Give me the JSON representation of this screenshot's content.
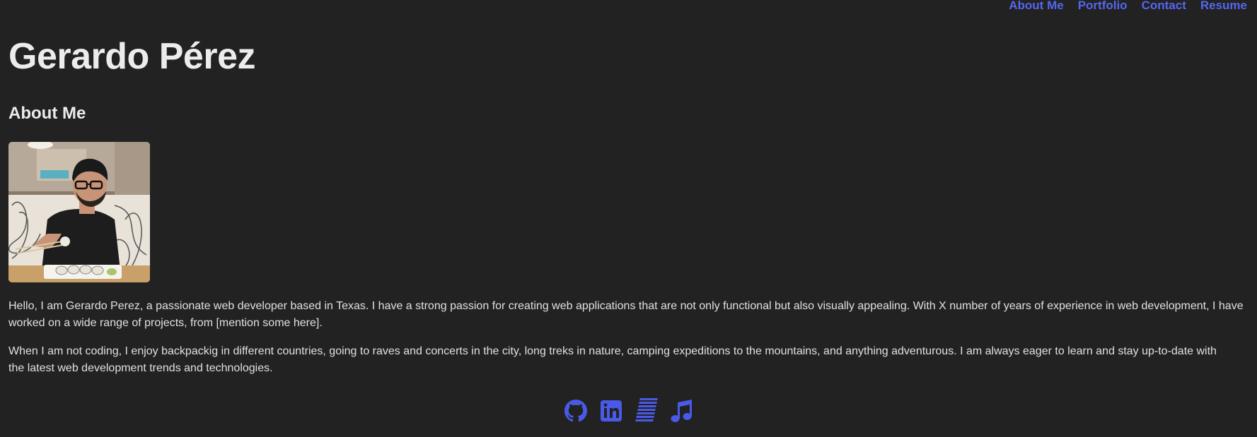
{
  "nav": {
    "items": [
      {
        "label": "About Me"
      },
      {
        "label": "Portfolio"
      },
      {
        "label": "Contact"
      },
      {
        "label": "Resume"
      }
    ]
  },
  "header": {
    "name": "Gerardo Pérez"
  },
  "about": {
    "title": "About Me",
    "paragraphs": [
      {
        "line1": "Hello, I am Gerardo Perez, a passionate web developer based in Texas. I have a strong passion for creating web applications that are not only functional but also visually appealing. With X number of years of experience in web development, I have",
        "line2": "worked on a wide range of projects, from [mention some here]."
      },
      {
        "line1": "When I am not coding, I enjoy backpackig in different countries, going to raves and concerts in the city, long treks in nature, camping expeditions to the mountains, and anything adventurous. I am always eager to learn and stay up-to-date with",
        "line2": "the latest web development trends and technologies."
      }
    ]
  },
  "social": {
    "icons": [
      "github-icon",
      "linkedin-icon",
      "resume-icon",
      "music-icon"
    ]
  },
  "colors": {
    "background": "#222222",
    "accent": "#5566ee",
    "text": "#e6e6e6"
  }
}
